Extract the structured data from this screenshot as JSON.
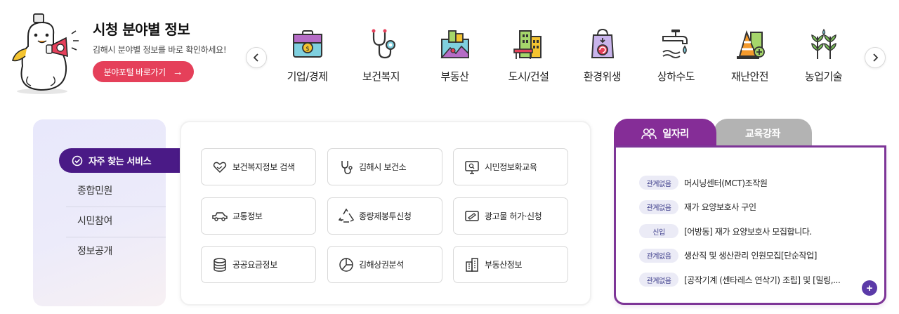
{
  "intro": {
    "title": "시청 분야별 정보",
    "description": "김해시 분야별 정보를 바로 확인하세요!",
    "portal_button": "분야포털 바로가기"
  },
  "fields": [
    {
      "label": "기업/경제",
      "icon": "briefcase-money-icon"
    },
    {
      "label": "보건복지",
      "icon": "stethoscope-icon"
    },
    {
      "label": "부동산",
      "icon": "city-map-icon"
    },
    {
      "label": "도시/건설",
      "icon": "buildings-icon"
    },
    {
      "label": "환경위생",
      "icon": "recycle-bag-icon"
    },
    {
      "label": "상하수도",
      "icon": "faucet-icon"
    },
    {
      "label": "재난안전",
      "icon": "traffic-cone-icon"
    },
    {
      "label": "농업기술",
      "icon": "crops-icon"
    }
  ],
  "services": {
    "tag_label": "자주 찾는 서비스",
    "menu": [
      "종합민원",
      "시민참여",
      "정보공개"
    ],
    "buttons": [
      {
        "label": "보건복지정보 검색",
        "icon": "heart-hands-icon"
      },
      {
        "label": "김해시 보건소",
        "icon": "stethoscope-icon"
      },
      {
        "label": "시민정보화교육",
        "icon": "monitor-search-icon"
      },
      {
        "label": "교통정보",
        "icon": "car-icon"
      },
      {
        "label": "종량제봉투신청",
        "icon": "recycle-icon"
      },
      {
        "label": "광고물 허가·신청",
        "icon": "billboard-icon"
      },
      {
        "label": "공공요금정보",
        "icon": "coins-stack-icon"
      },
      {
        "label": "김해상권분석",
        "icon": "pie-chart-icon"
      },
      {
        "label": "부동산정보",
        "icon": "building-icon"
      }
    ]
  },
  "jobs": {
    "tab_jobs": "일자리",
    "tab_edu": "교육강좌",
    "items": [
      {
        "badge": "관계없음",
        "title": "머시닝센터(MCT)조작원"
      },
      {
        "badge": "관계없음",
        "title": "재가 요양보호사 구인"
      },
      {
        "badge": "신입",
        "title": "[어방동] 재가 요양보호사 모집합니다."
      },
      {
        "badge": "관계없음",
        "title": "생산직 및 생산관리 인원모집[단순작업]"
      },
      {
        "badge": "관계없음",
        "title": "[공작기계 (센타레스 연삭기) 조립] 및 [밀링,..."
      }
    ],
    "more_label": "+"
  },
  "colors": {
    "accent_red": "#e5405a",
    "services_tag": "#4a1a86",
    "jobs_tab": "#852d97",
    "edu_tab": "#b3b3b3",
    "badge_bg": "#ebebf6"
  }
}
